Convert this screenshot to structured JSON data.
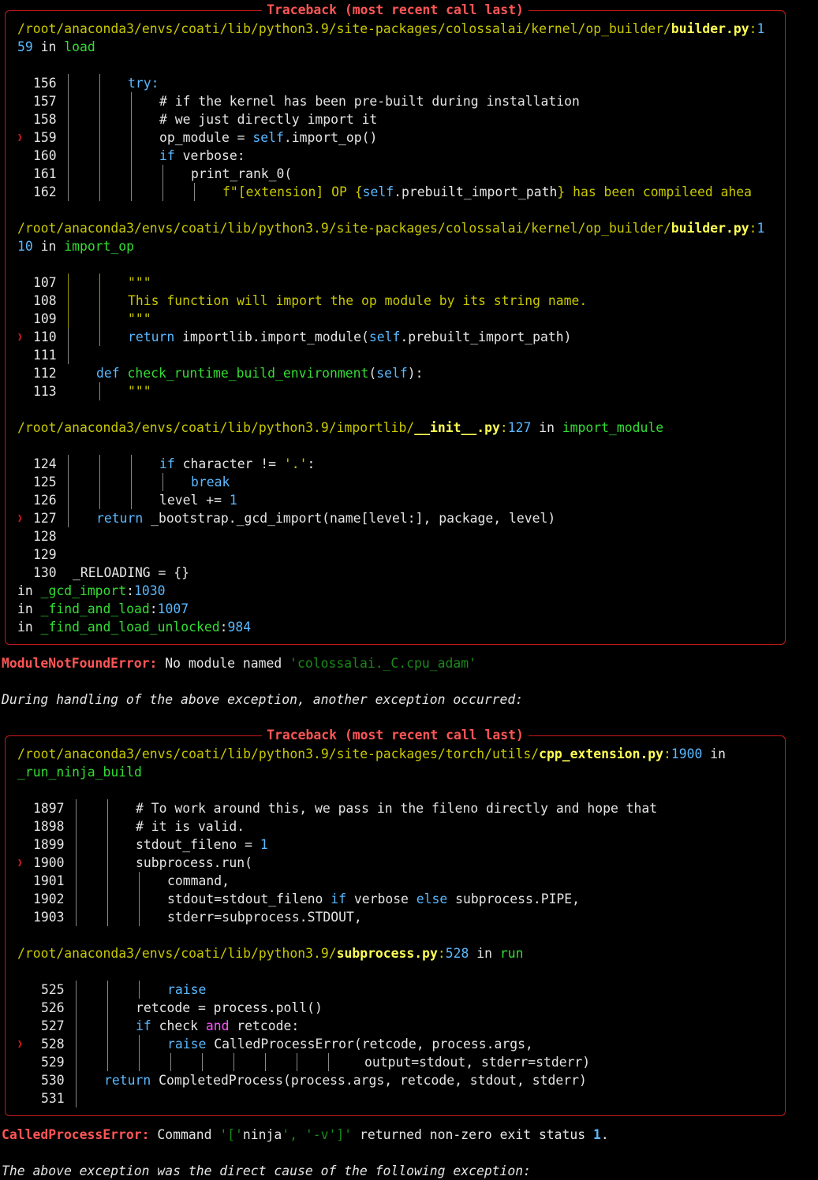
{
  "header": {
    "title": "Traceback (most recent call last)"
  },
  "tb1": {
    "f1": {
      "path_a": "/root/anaconda3/envs/coati/lib/python3.9/site-packages/colossalai/kernel/op_builder/",
      "file": "builder.py",
      "colon": ":",
      "line_a": "1",
      "line_b": "59",
      "in": " in ",
      "func": "load"
    },
    "f2": {
      "path_a": "/root/anaconda3/envs/coati/lib/python3.9/site-packages/colossalai/kernel/op_builder/",
      "file": "builder.py",
      "colon": ":",
      "line_a": "1",
      "line_b": "10",
      "in": " in ",
      "func": "import_op"
    },
    "f3": {
      "path_a": "/root/anaconda3/envs/coati/lib/python3.9/importlib/",
      "file": "__init__.py",
      "colon": ":",
      "line": "127",
      "in": " in ",
      "func": "import_module"
    },
    "frames_extra": [
      {
        "in": "in ",
        "func": "_gcd_import",
        "colon": ":",
        "line": "1030"
      },
      {
        "in": "in ",
        "func": "_find_and_load",
        "colon": ":",
        "line": "1007"
      },
      {
        "in": "in ",
        "func": "_find_and_load_unlocked",
        "colon": ":",
        "line": "984"
      }
    ]
  },
  "err1": {
    "name": "ModuleNotFoundError:",
    "msg": " No module named ",
    "mod": "'colossalai._C.cpu_adam'"
  },
  "during": "During handling of the above exception, another exception occurred:",
  "tb2": {
    "f1": {
      "path_a": "/root/anaconda3/envs/coati/lib/python3.9/site-packages/torch/utils/",
      "file": "cpp_extension.py",
      "colon": ":",
      "line": "1900",
      "in": " in",
      "func": "_run_ninja_build"
    },
    "f2": {
      "path_a": "/root/anaconda3/envs/coati/lib/python3.9/",
      "file": "subprocess.py",
      "colon": ":",
      "line": "528",
      "in": " in ",
      "func": "run"
    }
  },
  "err2": {
    "name": "CalledProcessError:",
    "msg_a": " Command ",
    "q1": "'['",
    "ninja": "ninja",
    "c1": "', '",
    "v": "-v",
    "q2": "']'",
    "msg_b": " returned non-zero exit status ",
    "status": "1",
    "dot": "."
  },
  "direct": "The above exception was the direct cause of the following exception:",
  "code": {
    "l156": "156",
    "l157": "157",
    "l158": "158",
    "l159": "159",
    "l160": "160",
    "l161": "161",
    "l162": "162",
    "c156": "try:",
    "c157": "# if the kernel has been pre-built during installation",
    "c158": "# we just directly import it",
    "c159a": "op_module = ",
    "c159b": "self",
    "c159c": ".import_op()",
    "c160a": "if",
    "c160b": " verbose:",
    "c161": "print_rank_0(",
    "c162a": "f\"[extension] OP {",
    "c162b": "self",
    "c162c": ".prebuilt_import_path",
    "c162d": "} has been compileed ahea",
    "l107": "107",
    "l108": "108",
    "l109": "109",
    "l110": "110",
    "l111": "111",
    "l112": "112",
    "l113": "113",
    "c107": "\"\"\"",
    "c108": "This function will import the op module by its string name.",
    "c109": "\"\"\"",
    "c110a": "return",
    "c110b": " importlib.import_module(",
    "c110c": "self",
    "c110d": ".prebuilt_import_path)",
    "c112a": "def",
    "c112b": " ",
    "c112c": "check_runtime_build_environment",
    "c112d": "(",
    "c112e": "self",
    "c112f": "):",
    "c113": "\"\"\"",
    "l124": "124",
    "l125": "125",
    "l126": "126",
    "l127": "127",
    "l128": "128",
    "l129": "129",
    "l130": "130",
    "c124a": "if",
    "c124b": " character != ",
    "c124c": "'.'",
    "c124d": ":",
    "c125": "break",
    "c126a": "level += ",
    "c126b": "1",
    "c127a": "return",
    "c127b": " _bootstrap._gcd_import(name[level:], package, level)",
    "c130": "_RELOADING = {}",
    "l1897": "1897",
    "l1898": "1898",
    "l1899": "1899",
    "l1900": "1900",
    "l1901": "1901",
    "l1902": "1902",
    "l1903": "1903",
    "c1897": "# To work around this, we pass in the fileno directly and hope that",
    "c1898": "# it is valid.",
    "c1899a": "stdout_fileno = ",
    "c1899b": "1",
    "c1900": "subprocess.run(",
    "c1901": "command,",
    "c1902a": "stdout=stdout_fileno ",
    "c1902b": "if",
    "c1902c": " verbose ",
    "c1902d": "else",
    "c1902e": " subprocess.PIPE,",
    "c1903": "stderr=subprocess.STDOUT,",
    "l525": "525",
    "l526": "526",
    "l527": "527",
    "l528": "528",
    "l529": "529",
    "l530": "530",
    "l531": "531",
    "c525": "raise",
    "c526": "retcode = process.poll()",
    "c527a": "if",
    "c527b": " check ",
    "c527c": "and",
    "c527d": " retcode:",
    "c528a": "raise",
    "c528b": " CalledProcessError(retcode, process.args,",
    "c529": "output=stdout, stderr=stderr)",
    "c530a": "return",
    "c530b": " CompletedProcess(process.args, retcode, stdout, stderr)"
  },
  "marker": "❱"
}
